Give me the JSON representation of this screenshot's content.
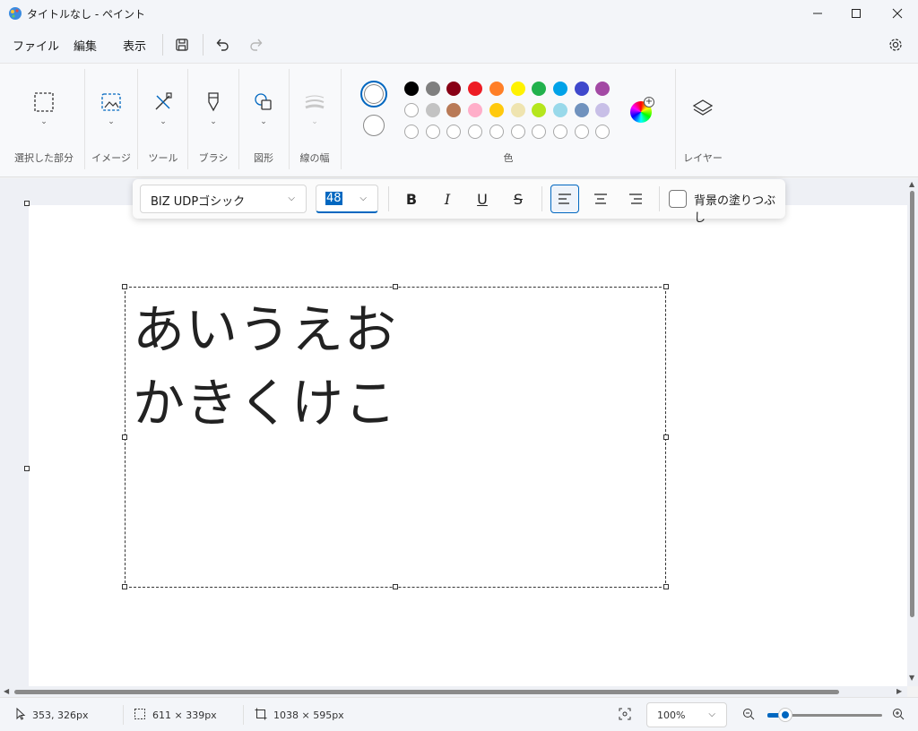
{
  "window": {
    "title": "タイトルなし - ペイント",
    "minimize_icon": "minimize-icon",
    "maximize_icon": "maximize-icon",
    "close_icon": "close-icon"
  },
  "menu": {
    "file": "ファイル",
    "edit": "編集",
    "view": "表示",
    "icons": [
      "save-icon",
      "undo-icon",
      "redo-icon",
      "settings-icon"
    ]
  },
  "ribbon": {
    "selection_label": "選択した部分",
    "image_label": "イメージ",
    "tools_label": "ツール",
    "brushes_label": "ブラシ",
    "shapes_label": "図形",
    "stroke_label": "線の幅",
    "colors_label": "色",
    "layers_label": "レイヤー"
  },
  "palette": {
    "row1": [
      "#000000",
      "#7f7f7f",
      "#880015",
      "#ed1c24",
      "#ff7f27",
      "#fff200",
      "#22b14c",
      "#00a2e8",
      "#3f48cc",
      "#a349a4"
    ],
    "row2": [
      "#ffffff",
      "#c3c3c3",
      "#b97a57",
      "#ffaec9",
      "#ffc90e",
      "#efe4b0",
      "#b5e61d",
      "#99d9ea",
      "#7092be",
      "#c8bfe7"
    ],
    "row3_empty_count": 10
  },
  "text_toolbar": {
    "font": "BIZ UDPゴシック",
    "size": "48",
    "bold": "B",
    "italic": "I",
    "underline": "U",
    "strikethrough": "S",
    "fill_background": "背景の塗りつぶし",
    "alignment_selected": "left"
  },
  "canvas_text": {
    "line1": "あいうえお",
    "line2": "かきくけこ"
  },
  "status": {
    "cursor_pos": "353, 326px",
    "selection_size": "611 × 339px",
    "canvas_size": "1038 × 595px",
    "zoom": "100%",
    "zoom_level_fraction": 0.16
  }
}
